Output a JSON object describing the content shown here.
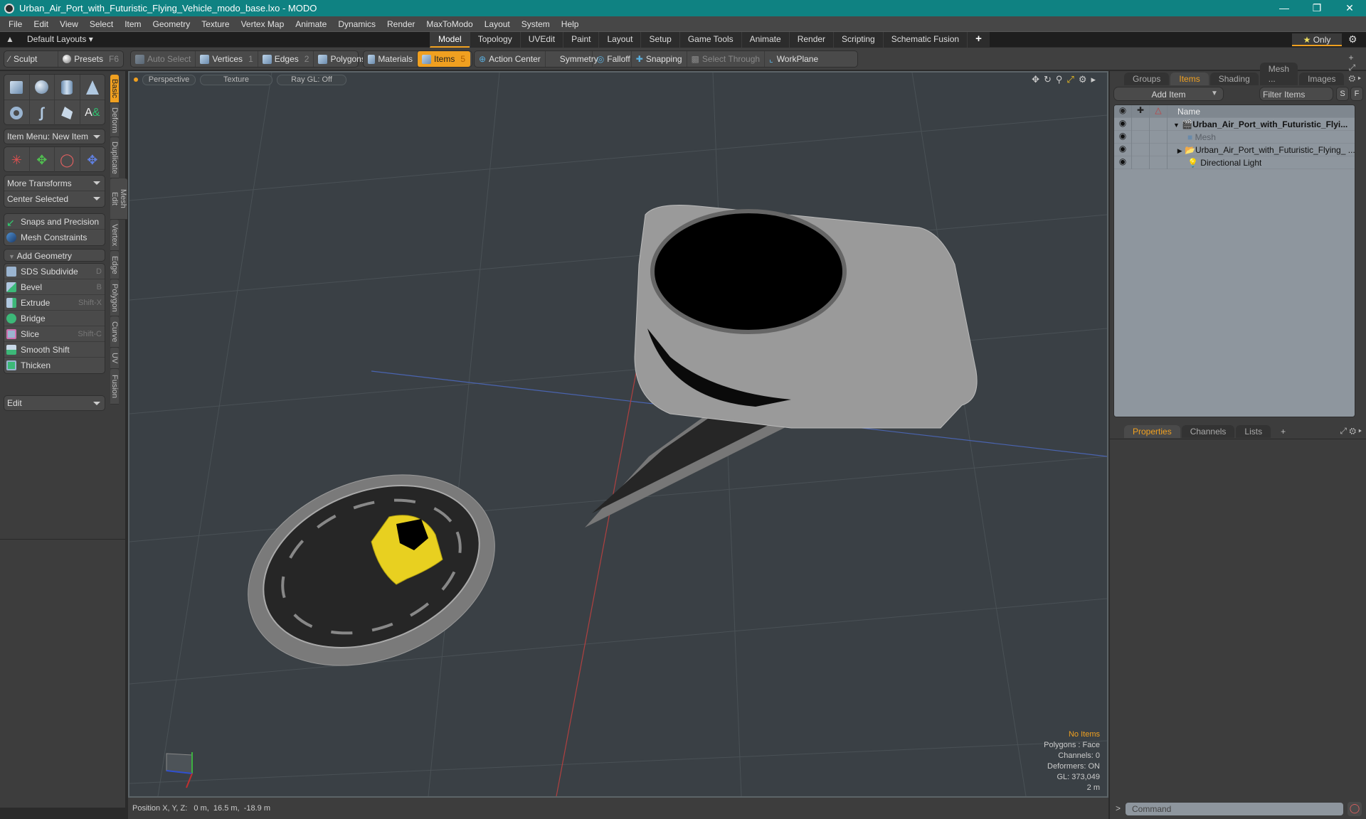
{
  "window": {
    "title": "Urban_Air_Port_with_Futuristic_Flying_Vehicle_modo_base.lxo - MODO",
    "controls": [
      "minimize",
      "restore",
      "close"
    ]
  },
  "menubar": [
    "File",
    "Edit",
    "View",
    "Select",
    "Item",
    "Geometry",
    "Texture",
    "Vertex Map",
    "Animate",
    "Dynamics",
    "Render",
    "MaxToModo",
    "Layout",
    "System",
    "Help"
  ],
  "layoutbar": {
    "layouts_label": "Default Layouts",
    "tabs": [
      "Model",
      "Topology",
      "UVEdit",
      "Paint",
      "Layout",
      "Setup",
      "Game Tools",
      "Animate",
      "Render",
      "Scripting",
      "Schematic Fusion"
    ],
    "active_tab": "Model",
    "add_tab": "+",
    "only_label": "Only"
  },
  "toolbar": {
    "sculpt": "Sculpt",
    "presets": "Presets",
    "presets_key": "F6",
    "auto_select": "Auto Select",
    "vertices": "Vertices",
    "vertices_key": "1",
    "edges": "Edges",
    "edges_key": "2",
    "polygons": "Polygons",
    "materials": "Materials",
    "items": "Items",
    "items_key": "5",
    "action_center": "Action Center",
    "symmetry": "Symmetry",
    "falloff": "Falloff",
    "snapping": "Snapping",
    "select_through": "Select Through",
    "workplane": "WorkPlane"
  },
  "leftpanel": {
    "item_menu": "Item Menu: New Item",
    "more_transforms": "More Transforms",
    "center_selected": "Center Selected",
    "snaps": "Snaps and Precision",
    "mesh_constraints": "Mesh Constraints",
    "add_geometry": "Add Geometry",
    "tools": [
      {
        "label": "SDS Subdivide",
        "key": "D",
        "color": "#9ab4d0"
      },
      {
        "label": "Bevel",
        "key": "B",
        "color": "#3cb878"
      },
      {
        "label": "Extrude",
        "key": "Shift-X",
        "color": "#3cb878"
      },
      {
        "label": "Bridge",
        "key": "",
        "color": "#3cb878"
      },
      {
        "label": "Slice",
        "key": "Shift-C",
        "color": "#d070b0"
      },
      {
        "label": "Smooth Shift",
        "key": "",
        "color": "#3cb878"
      },
      {
        "label": "Thicken",
        "key": "",
        "color": "#3cb878"
      }
    ],
    "edit_dropdown": "Edit",
    "side_tabs": [
      "Basic",
      "Deform",
      "Duplicate",
      "Mesh Edit",
      "Vertex",
      "Edge",
      "Polygon",
      "Curve",
      "UV",
      "Fusion"
    ],
    "active_side_tab": "Basic"
  },
  "viewport": {
    "view_mode": "Perspective",
    "shading": "Texture",
    "raygl": "Ray GL: Off",
    "info": {
      "selection": "No Items",
      "polygons": "Polygons : Face",
      "channels": "Channels: 0",
      "deformers": "Deformers: ON",
      "gl": "GL: 373,049",
      "scale": "2 m"
    }
  },
  "statusbar": {
    "position": "Position X, Y, Z:   0 m,  16.5 m,  -18.9 m"
  },
  "rightpanel": {
    "top_tabs": [
      "Groups",
      "Items",
      "Shading",
      "Mesh ...",
      "Images"
    ],
    "active_top_tab": "Items",
    "add_item": "Add Item",
    "filter_placeholder": "Filter Items",
    "s_btn": "S",
    "f_btn": "F",
    "column_name": "Name",
    "items": [
      {
        "label": "Urban_Air_Port_with_Futuristic_Flyi...",
        "type": "scene",
        "bold": true
      },
      {
        "label": "Mesh",
        "type": "mesh",
        "dim": true
      },
      {
        "label": "Urban_Air_Port_with_Futuristic_Flying_ ...",
        "type": "group"
      },
      {
        "label": "Directional Light",
        "type": "light"
      }
    ],
    "bottom_tabs": [
      "Properties",
      "Channels",
      "Lists"
    ],
    "active_bottom_tab": "Properties",
    "command_placeholder": "Command"
  },
  "colors": {
    "accent": "#f0a020",
    "titlebar": "#0f8282"
  }
}
